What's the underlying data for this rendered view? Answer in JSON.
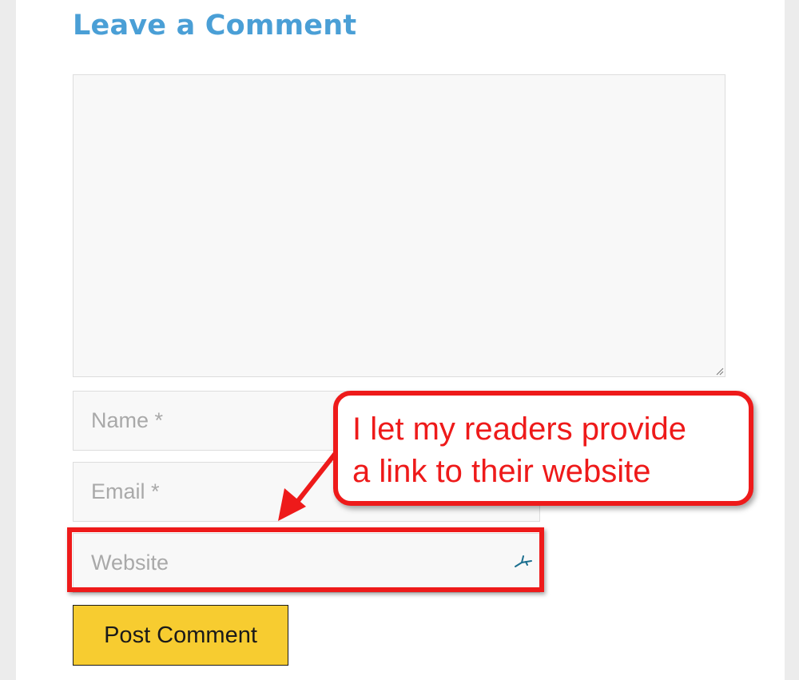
{
  "heading": "Leave a Comment",
  "form": {
    "comment_value": "",
    "name_placeholder": "Name *",
    "email_placeholder": "Email *",
    "website_placeholder": "Website",
    "submit_label": "Post Comment"
  },
  "annotation": {
    "line1": "I let my readers provide",
    "line2": "a link to their website"
  },
  "colors": {
    "heading": "#4a9fd6",
    "button": "#f7cc30",
    "annotation_red": "#ee1a1a",
    "field_bg": "#f8f8f8"
  },
  "icons": {
    "resize": "resize-grip-icon",
    "autofill": "autofill-key-icon",
    "arrow": "arrow-icon"
  }
}
